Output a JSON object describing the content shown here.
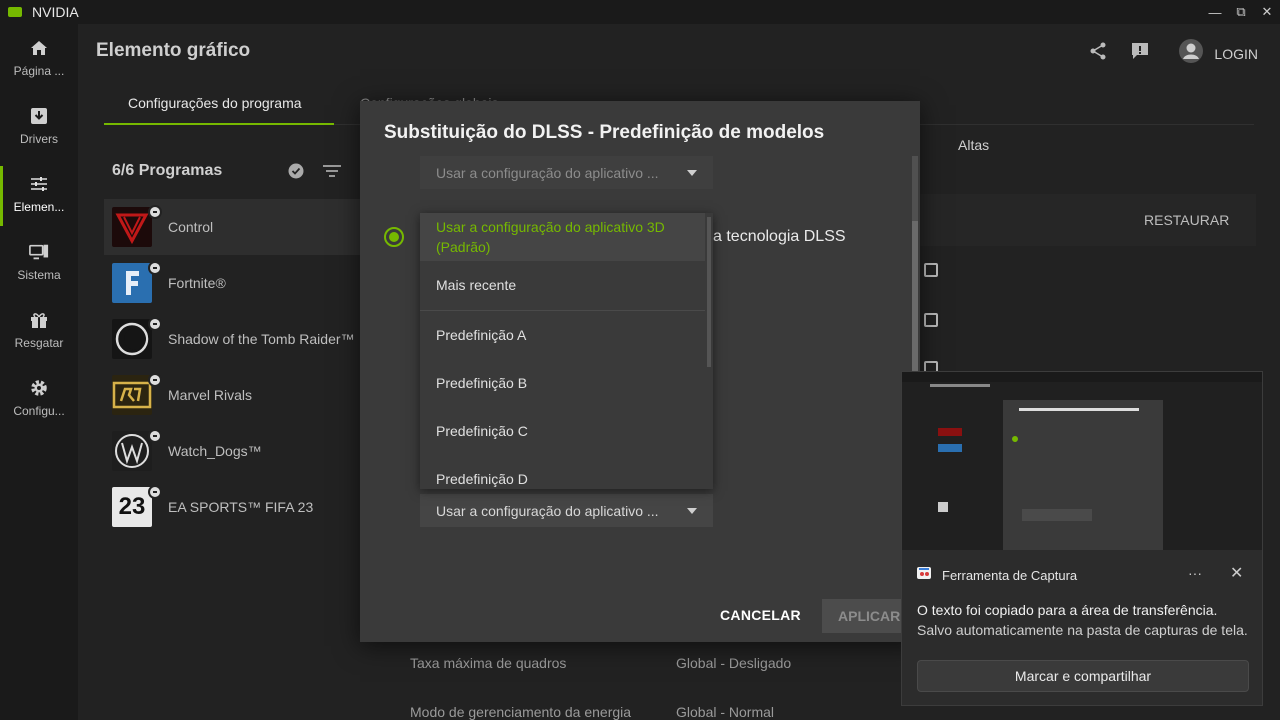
{
  "window": {
    "app_title": "NVIDIA",
    "minimize": "—",
    "maximize": "⧉",
    "close": "✕"
  },
  "sidebar": {
    "items": [
      {
        "label": "Página ...",
        "icon": "home-icon"
      },
      {
        "label": "Drivers",
        "icon": "download-icon"
      },
      {
        "label": "Elemen...",
        "icon": "sliders-icon",
        "active": true
      },
      {
        "label": "Sistema",
        "icon": "monitor-icon"
      },
      {
        "label": "Resgatar",
        "icon": "gift-icon"
      },
      {
        "label": "Configu...",
        "icon": "gear-icon"
      }
    ]
  },
  "header": {
    "title": "Elemento gráfico",
    "login": "LOGIN"
  },
  "tabs": {
    "program": "Configurações do programa",
    "global": "Configurações globais"
  },
  "programs": {
    "count": "6/6 Programas",
    "items": [
      "Control",
      "Fortnite®",
      "Shadow of the Tomb Raider™",
      "Marvel Rivals",
      "Watch_Dogs™",
      "EA SPORTS™ FIFA 23"
    ]
  },
  "right": {
    "altas": "Altas",
    "restaurar": "RESTAURAR"
  },
  "background_rows": [
    {
      "label": "Taxa máxima de quadros",
      "value": "Global - Desligado"
    },
    {
      "label": "Modo de gerenciamento da energia",
      "value": "Global - Normal"
    }
  ],
  "dialog": {
    "title": "Substituição do DLSS - Predefinição de modelos",
    "top_select": "Usar a configuração do aplicativo ...",
    "radio_text": "a tecnologia DLSS",
    "bottom_select": "Usar a configuração do aplicativo ...",
    "cancel": "CANCELAR",
    "apply": "APLICAR",
    "dropdown": {
      "selected": "Usar a configuração do aplicativo 3D (Padrão)",
      "options": [
        "Mais recente",
        "Predefinição A",
        "Predefinição B",
        "Predefinição C",
        "Predefinição D"
      ]
    }
  },
  "toast": {
    "app": "Ferramenta de Captura",
    "more": "···",
    "close": "✕",
    "line1": "O texto foi copiado para a área de transferência.",
    "line2": "Salvo automaticamente na pasta de capturas de tela.",
    "button": "Marcar e compartilhar"
  },
  "colors": {
    "accent": "#76b900",
    "dialog_bg": "#3a3a3a",
    "app_bg": "#222222"
  }
}
